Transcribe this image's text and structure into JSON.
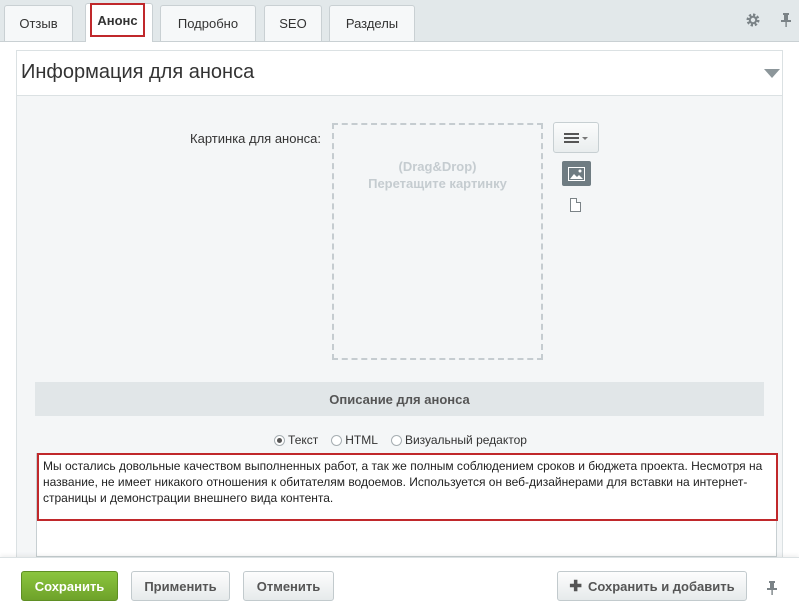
{
  "tabs": [
    {
      "label": "Отзыв"
    },
    {
      "label": "Анонс"
    },
    {
      "label": "Подробно"
    },
    {
      "label": "SEO"
    },
    {
      "label": "Разделы"
    }
  ],
  "section": {
    "title": "Информация для анонса"
  },
  "picture": {
    "label": "Картинка для анонса:",
    "dropzone_line1": "(Drag&Drop)",
    "dropzone_line2": "Перетащите картинку"
  },
  "description": {
    "header": "Описание для анонса",
    "modes": [
      "Текст",
      "HTML",
      "Визуальный редактор"
    ],
    "selected_mode": "Текст",
    "text": "Мы остались довольные качеством выполненных работ, а так же полным соблюдением сроков и бюджета проекта. Несмотря на название, не имеет никакого отношения к обитателям водоемов. Используется он веб-дизайнерами для вставки на интернет-страницы и демонстрации внешнего вида контента."
  },
  "buttons": {
    "save": "Сохранить",
    "apply": "Применить",
    "cancel": "Отменить",
    "save_add": "Сохранить и добавить"
  },
  "colors": {
    "save_green": "#7cb733",
    "highlight_red": "#c0282b"
  }
}
